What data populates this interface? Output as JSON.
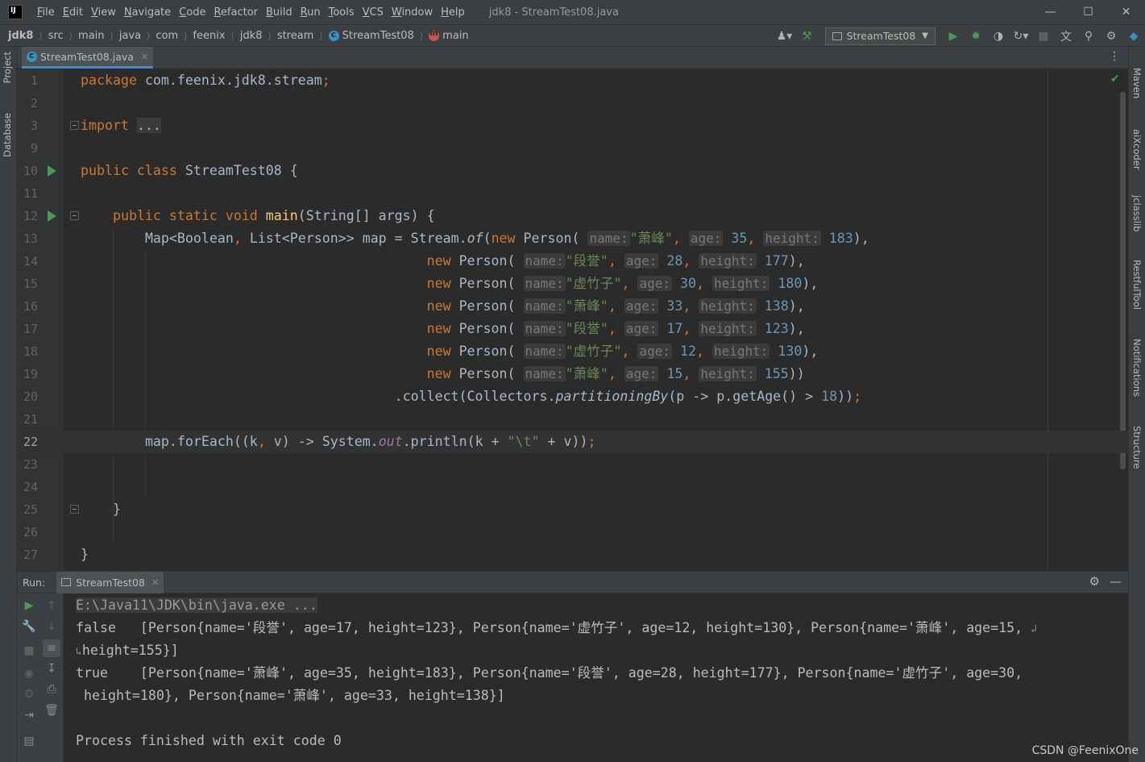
{
  "titlebar": {
    "menu": [
      "File",
      "Edit",
      "View",
      "Navigate",
      "Code",
      "Refactor",
      "Build",
      "Run",
      "Tools",
      "VCS",
      "Window",
      "Help"
    ],
    "title": "jdk8 - StreamTest08.java"
  },
  "breadcrumbs": [
    "jdk8",
    "src",
    "main",
    "java",
    "com",
    "feenix",
    "jdk8",
    "stream",
    "StreamTest08",
    "main"
  ],
  "run_config": "StreamTest08",
  "editor_tab": "StreamTest08.java",
  "left_tools": [
    "Project",
    "Database"
  ],
  "right_tools": [
    "Maven",
    "aiXcoder",
    "jclasslib",
    "RestfulTool",
    "Notifications",
    "Structure"
  ],
  "code": {
    "line_numbers": [
      "1",
      "2",
      "3",
      "9",
      "10",
      "11",
      "12",
      "13",
      "14",
      "15",
      "16",
      "17",
      "18",
      "19",
      "20",
      "21",
      "22",
      "23",
      "24",
      "25",
      "26",
      "27"
    ],
    "kw_package": "package",
    "package_name": " com.feenix.jdk8.stream",
    "semi": ";",
    "kw_import": "import",
    "fold_dots": "...",
    "kw_public_class": "public class",
    "class_name": " StreamTest08 {",
    "kw_psv": "public static void",
    "main_name": "main",
    "main_sig": "(String[] args) {",
    "map_decl_a": "Map<Boolean",
    "comma": ",",
    "map_decl_b": " List<Person>> map = Stream.",
    "of": "of",
    "paren": "(",
    "kw_new": "new",
    "person": " Person(",
    "hint_name": "name:",
    "hint_age": "age:",
    "hint_height": "height:",
    "persons": [
      {
        "name": "\"萧峰\"",
        "age": "35",
        "height": "183",
        "end": "),"
      },
      {
        "name": "\"段誉\"",
        "age": "28",
        "height": "177",
        "end": "),"
      },
      {
        "name": "\"虚竹子\"",
        "age": "30",
        "height": "180",
        "end": "),"
      },
      {
        "name": "\"萧峰\"",
        "age": "33",
        "height": "138",
        "end": "),"
      },
      {
        "name": "\"段誉\"",
        "age": "17",
        "height": "123",
        "end": "),"
      },
      {
        "name": "\"虚竹子\"",
        "age": "12",
        "height": "130",
        "end": "),"
      },
      {
        "name": "\"萧峰\"",
        "age": "15",
        "height": "155",
        "end": "))"
      }
    ],
    "collect_a": ".collect(Collectors.",
    "partitioning": "partitioningBy",
    "collect_b": "(p -> p.getAge() > ",
    "num18": "18",
    "collect_c": "))",
    "foreach_a": "map.forEach((k",
    "foreach_b": " v) -> System.",
    "out": "out",
    "foreach_c": ".println(k + ",
    "tab_str": "\"\\t\"",
    "foreach_d": " + v))",
    "close_brace_method": "}",
    "close_brace_class": "}"
  },
  "run_panel": {
    "label": "Run:",
    "tab": "StreamTest08",
    "console": [
      "E:\\Java11\\JDK\\bin\\java.exe ...",
      "false   [Person{name='段誉', age=17, height=123}, Person{name='虚竹子', age=12, height=130}, Person{name='萧峰', age=15, ",
      "height=155}]",
      "true    [Person{name='萧峰', age=35, height=183}, Person{name='段誉', age=28, height=177}, Person{name='虚竹子', age=30,",
      " height=180}, Person{name='萧峰', age=33, height=138}]",
      "Process finished with exit code 0"
    ]
  },
  "watermark": "CSDN @FeenixOne"
}
